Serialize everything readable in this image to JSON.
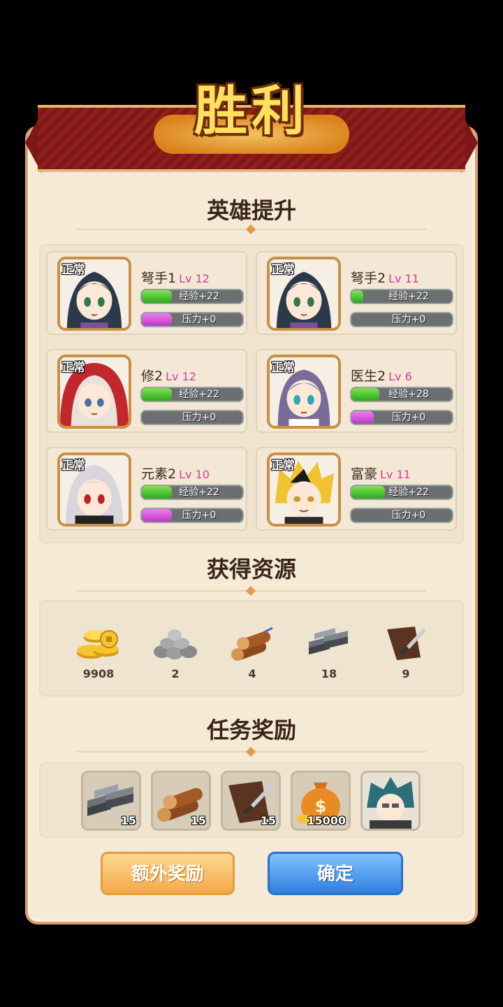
{
  "title": "胜利",
  "sections": {
    "hero": "英雄提升",
    "resources": "获得资源",
    "tasks": "任务奖励"
  },
  "heroes": [
    {
      "status": "正常",
      "name": "弩手1",
      "level": "Lv 12",
      "exp": "经验+22",
      "exp_fill": 0.3,
      "stress": "压力+0",
      "stress_fill": 0.3,
      "hair": "#2b3a4a",
      "accent": "#7b4fa0"
    },
    {
      "status": "正常",
      "name": "弩手2",
      "level": "Lv 11",
      "exp": "经验+22",
      "exp_fill": 0.12,
      "stress": "压力+0",
      "stress_fill": 0,
      "hair": "#2b3a4a",
      "accent": "#7b4fa0"
    },
    {
      "status": "正常",
      "name": "修2",
      "level": "Lv 12",
      "exp": "经验+22",
      "exp_fill": 0.3,
      "stress": "压力+0",
      "stress_fill": 0,
      "hair": "#e8e2da",
      "accent": "#c1272d"
    },
    {
      "status": "正常",
      "name": "医生2",
      "level": "Lv 6",
      "exp": "经验+28",
      "exp_fill": 0.28,
      "stress": "压力+0",
      "stress_fill": 0.22,
      "hair": "#7a6c98",
      "accent": "#ffffff"
    },
    {
      "status": "正常",
      "name": "元素2",
      "level": "Lv 10",
      "exp": "经验+22",
      "exp_fill": 0.3,
      "stress": "压力+0",
      "stress_fill": 0.3,
      "hair": "#d8d6dc",
      "accent": "#222222"
    },
    {
      "status": "正常",
      "name": "富豪",
      "level": "Lv 11",
      "exp": "经验+22",
      "exp_fill": 0.33,
      "stress": "压力+0",
      "stress_fill": 0,
      "hair": "#f1c232",
      "accent": "#2a2a2a"
    }
  ],
  "resources": [
    {
      "icon": "gold-coins-icon",
      "count": "9908"
    },
    {
      "icon": "stone-pile-icon",
      "count": "2"
    },
    {
      "icon": "wood-logs-icon",
      "count": "4"
    },
    {
      "icon": "iron-ingot-icon",
      "count": "18"
    },
    {
      "icon": "leather-knife-icon",
      "count": "9"
    }
  ],
  "rewards": [
    {
      "icon": "iron-ingot-icon",
      "count": "15"
    },
    {
      "icon": "wood-logs-icon",
      "count": "15"
    },
    {
      "icon": "leather-knife-icon",
      "count": "15"
    },
    {
      "icon": "money-bag-icon",
      "count": "15000"
    },
    {
      "icon": "hero-portrait-icon",
      "count": ""
    }
  ],
  "buttons": {
    "extra": "额外奖励",
    "confirm": "确定"
  },
  "colors": {
    "panel": "#f4ead6",
    "ribbon": "#8e1f1c",
    "level_text": "#d93aa0",
    "exp_bar": "#2ea819",
    "stress_bar": "#b93bc4"
  }
}
